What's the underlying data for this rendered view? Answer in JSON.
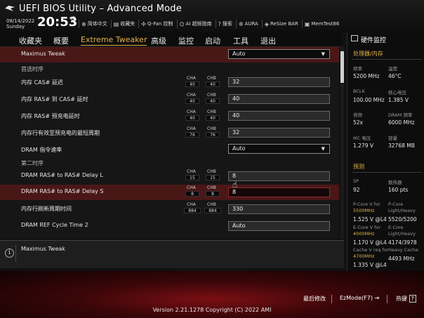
{
  "header": {
    "title": "UEFI BIOS Utility – Advanced Mode",
    "date": "08/14/2022",
    "day": "Sunday",
    "time": "20:53",
    "tools": [
      {
        "icon": "globe-icon",
        "label": "简体中文"
      },
      {
        "icon": "bookmark-icon",
        "label": "收藏夹"
      },
      {
        "icon": "fan-icon",
        "label": "Q-Fan 控制"
      },
      {
        "icon": "ai-icon",
        "label": "AI 超频指南"
      },
      {
        "icon": "help-icon",
        "label": "搜索"
      },
      {
        "icon": "aura-icon",
        "label": "AURA"
      },
      {
        "icon": "resize-bar-icon",
        "label": "ReSize BAR"
      },
      {
        "icon": "memtest-icon",
        "label": "MemTest86"
      }
    ]
  },
  "nav": {
    "tabs": [
      "收藏夹",
      "概要",
      "Extreme Tweaker",
      "高级",
      "监控",
      "启动",
      "工具",
      "退出"
    ],
    "active_index": 2
  },
  "content": {
    "maximus_tweak": {
      "label": "Maximus Tweak",
      "value": "Auto"
    },
    "section_primary": "首选时序",
    "section_secondary": "第二时序",
    "ch_labels": {
      "a": "CHA",
      "b": "CHB"
    },
    "rows": [
      {
        "label": "内存 CAS# 延迟",
        "cha": "40",
        "chb": "40",
        "value": "32",
        "kind": "field"
      },
      {
        "label": "内存 RAS# 到 CAS# 延时",
        "cha": "40",
        "chb": "40",
        "value": "40",
        "kind": "field"
      },
      {
        "label": "内存 RAS# 预充电延时",
        "cha": "40",
        "chb": "40",
        "value": "40",
        "kind": "field"
      },
      {
        "label": "内存行有效至预充电的最短周期",
        "cha": "76",
        "chb": "76",
        "value": "32",
        "kind": "field"
      },
      {
        "label": "DRAM 指令速率",
        "value": "Auto",
        "kind": "dropdown"
      },
      {
        "label": "DRAM RAS# to RAS# Delay L",
        "cha": "15",
        "chb": "15",
        "value": "8",
        "kind": "field"
      },
      {
        "label": "DRAM RAS# to RAS# Delay S",
        "cha": "8",
        "chb": "8",
        "value": "8",
        "kind": "field-active"
      },
      {
        "label": "内存行刷新周期时间",
        "cha": "884",
        "chb": "884",
        "value": "330",
        "kind": "field"
      },
      {
        "label": "DRAM REF Cycle Time 2",
        "value": "Auto",
        "kind": "field"
      }
    ]
  },
  "help": {
    "text": "Maximus Tweak"
  },
  "monitor": {
    "title": "硬件监控",
    "group_cpu": "处理器/内存",
    "group_predict": "预测",
    "cpu": [
      {
        "k1": "频率",
        "v1": "5200 MHz",
        "k2": "温度",
        "v2": "46°C"
      },
      {
        "k1": "BCLK",
        "v1": "100.00 MHz",
        "k2": "核心电压",
        "v2": "1.385 V"
      },
      {
        "k1": "倍频",
        "v1": "52x",
        "k2": "DRAM 频率",
        "v2": "6000 MHz"
      },
      {
        "k1": "MC 电压",
        "v1": "1.279 V",
        "k2": "容量",
        "v2": "32768 MB"
      }
    ],
    "predict": {
      "sp_label": "SP",
      "sp": "92",
      "cooler_label": "散热器",
      "cooler": "160 pts",
      "pcore_label": "P-Core V for",
      "pcore_freq": "5500MHz",
      "pcore_v": "1.525 V @L4",
      "pcore_lh_label": "P-Core Light/Heavy",
      "pcore_lh": "5520/5200",
      "ecore_label": "E-Core V for",
      "ecore_freq": "4000MHz",
      "ecore_v": "1.170 V @L4",
      "ecore_lh_label": "E-Core Light/Heavy",
      "ecore_lh": "4174/3978",
      "cache_label": "Cache V req for",
      "cache_freq": "4700MHz",
      "cache_v": "1.335 V @L4",
      "heavy_cache_label": "Heavy Cache",
      "heavy_cache": "4493 MHz"
    }
  },
  "footer": {
    "last_modified": "最后修改",
    "ezmode": "EzMode(F7)",
    "hotkeys": "热键",
    "hotkey_symbol": "?",
    "version": "Version 2.21.1278 Copyright (C) 2022 AMI"
  },
  "colors": {
    "accent": "#e2b247",
    "selected_row": "#4a1717",
    "footer_red": "#7a0f14"
  }
}
